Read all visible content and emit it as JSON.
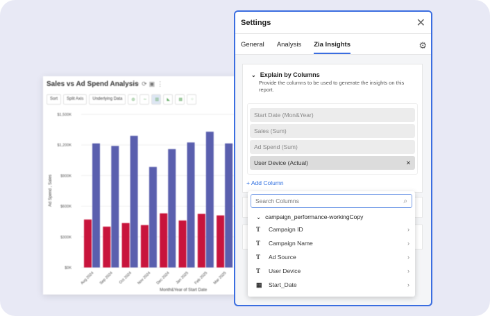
{
  "chart_card": {
    "title": "Sales vs Ad Spend Analysis",
    "toolbar": [
      "Sort",
      "Split Axis",
      "Underlying Data"
    ]
  },
  "chart_data": {
    "type": "bar",
    "title": "Sales vs Ad Spend Analysis",
    "xlabel": "Month&Year of Start Date",
    "ylabel": "Ad Spend , Sales",
    "ylim": [
      0,
      1500
    ],
    "yticks": [
      "$0K",
      "$300K",
      "$600K",
      "$900K",
      "$1,200K",
      "$1,500K"
    ],
    "categories": [
      "Aug 2024",
      "Sep 2024",
      "Oct 2024",
      "Nov 2024",
      "Dec 2024",
      "Jan 2025",
      "Feb 2025",
      "Mar 2025"
    ],
    "series": [
      {
        "color": "#c8143c",
        "values": [
          470,
          400,
          435,
          415,
          530,
          460,
          525,
          510
        ]
      },
      {
        "color": "#5a5fae",
        "values": [
          1215,
          1190,
          1290,
          985,
          1160,
          1225,
          1330,
          1215
        ]
      }
    ],
    "grid": true,
    "units": "K$"
  },
  "settings": {
    "title": "Settings",
    "tabs": [
      "General",
      "Analysis",
      "Zia Insights"
    ],
    "active_tab": "Zia Insights",
    "section": {
      "title": "Explain by Columns",
      "description": "Provide the columns to be used to generate the insights on this report.",
      "columns": [
        "Start Date (Mon&Year)",
        "Sales (Sum)",
        "Ad Spend (Sum)",
        "User Device (Actual)"
      ],
      "add_label": "+ Add Column"
    }
  },
  "dropdown": {
    "search_placeholder": "Search Columns",
    "group": "campaign_performance-workingCopy",
    "items": [
      {
        "label": "Campaign ID",
        "icon": "text-icon"
      },
      {
        "label": "Campaign Name",
        "icon": "text-icon"
      },
      {
        "label": "Ad Source",
        "icon": "text-icon"
      },
      {
        "label": "User Device",
        "icon": "text-icon"
      },
      {
        "label": "Start_Date",
        "icon": "calendar-icon"
      }
    ]
  },
  "colors": {
    "accent": "#3a6de0",
    "sales": "#c8143c",
    "ad_spend": "#5a5fae"
  }
}
